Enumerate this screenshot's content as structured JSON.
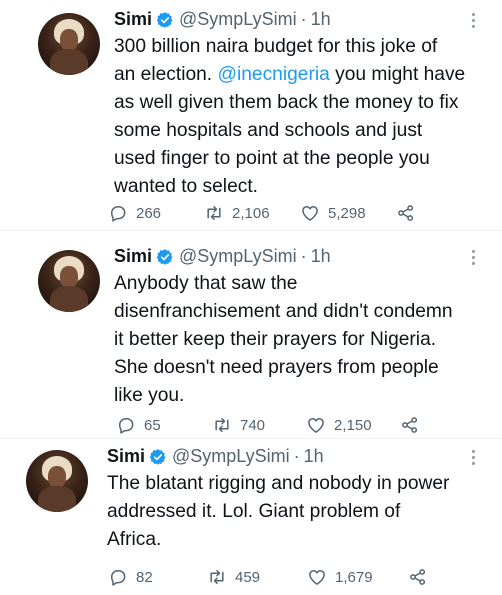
{
  "tweets": [
    {
      "author": "Simi",
      "handle": "@SympLySimi",
      "separator": "·",
      "time": "1h",
      "text_before": "300 billion naira budget for this joke of\nan election. ",
      "mention": "@inecnigeria",
      "text_after": " you might have\nas well given them back the money to fix\nsome hospitals and schools and just\nused finger to point at the people you\nwanted to select.",
      "replies": "266",
      "retweets": "2,106",
      "likes": "5,298"
    },
    {
      "author": "Simi",
      "handle": "@SympLySimi",
      "separator": "·",
      "time": "1h",
      "text": "Anybody that saw the\ndisenfranchisement and didn't condemn\nit better keep their prayers for Nigeria.\nShe doesn't need prayers from people\nlike you.",
      "replies": "65",
      "retweets": "740",
      "likes": "2,150"
    },
    {
      "author": "Simi",
      "handle": "@SympLySimi",
      "separator": "·",
      "time": "1h",
      "text": "The blatant rigging and nobody in power\naddressed it. Lol. Giant problem of\nAfrica.",
      "replies": "82",
      "retweets": "459",
      "likes": "1,679"
    }
  ],
  "icons": {
    "verified": "verified-badge-icon",
    "reply": "reply-icon",
    "retweet": "retweet-icon",
    "like": "heart-icon",
    "share": "share-icon",
    "more": "more-icon"
  },
  "colors": {
    "verified": "#1d9bf0",
    "mention": "#1d9bf0",
    "secondary_text": "#536471",
    "primary_text": "#0f1419"
  }
}
